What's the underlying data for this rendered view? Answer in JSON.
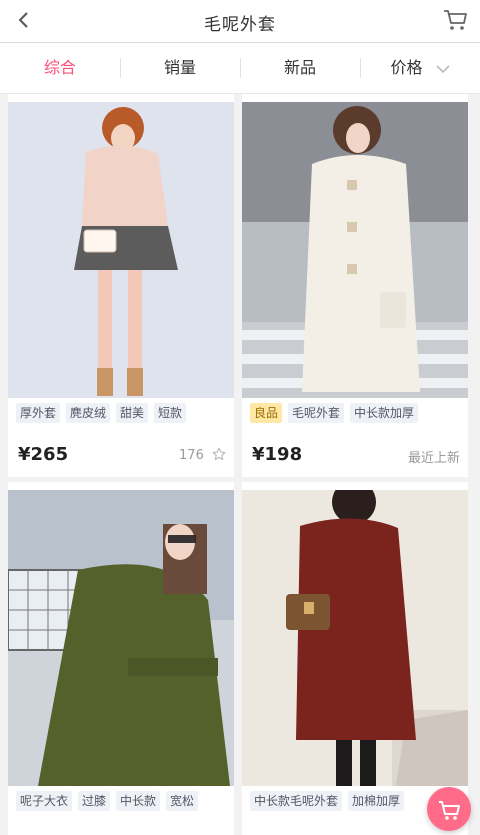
{
  "header": {
    "title": "毛呢外套"
  },
  "sort": {
    "items": [
      {
        "label": "综合"
      },
      {
        "label": "销量"
      },
      {
        "label": "新品"
      },
      {
        "label": "价格"
      }
    ]
  },
  "products": [
    {
      "tags": [
        "厚外套",
        "麂皮绒",
        "甜美",
        "短款"
      ],
      "price": "¥265",
      "meta": "176"
    },
    {
      "tags": [
        "良品",
        "毛呢外套",
        "中长款加厚"
      ],
      "price": "¥198",
      "meta": "最近上新"
    },
    {
      "tags": [
        "呢子大衣",
        "过膝",
        "中长款",
        "宽松"
      ],
      "price": "",
      "meta": ""
    },
    {
      "tags": [
        "中长款毛呢外套",
        "加棉加厚"
      ],
      "price": "",
      "meta": ""
    }
  ],
  "colors": {
    "accent": "#ff4f7a",
    "fab": "#ff6b88"
  },
  "icons": {
    "back": "chevron-left-icon",
    "cart": "cart-icon",
    "sort_chevron": "chevron-down-icon",
    "favorite": "star-icon"
  }
}
